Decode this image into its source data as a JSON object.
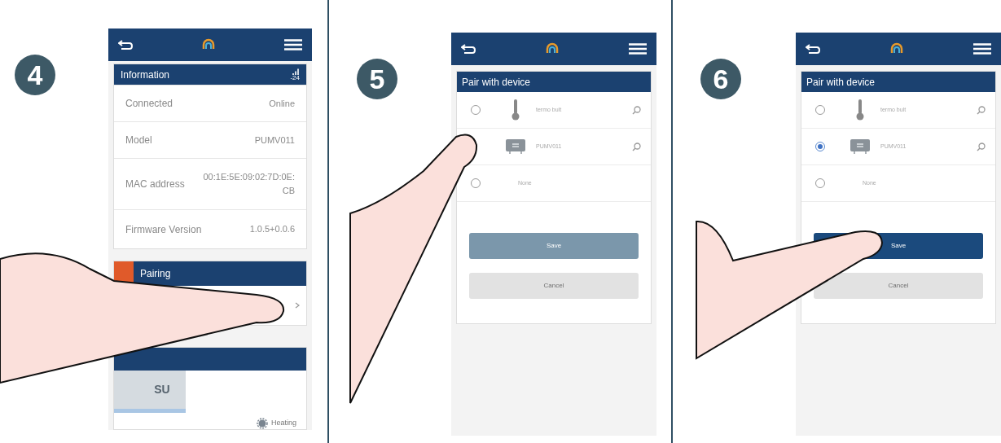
{
  "panels": [
    {
      "step": "4",
      "screen": {
        "kind": "info",
        "info_title": "Information",
        "signal": "-24",
        "rows": [
          {
            "label": "Connected",
            "value": "Online"
          },
          {
            "label": "Model",
            "value": "PUMV011"
          },
          {
            "label": "MAC address",
            "value": "00:1E:5E:09:02:7D:0E:\nCB"
          },
          {
            "label": "Firmware Version",
            "value": "1.0.5+0.0.6"
          }
        ],
        "pairing_title": "Pairing",
        "schedule": "SU",
        "mode": "Heating"
      }
    },
    {
      "step": "5",
      "screen": {
        "kind": "pair",
        "title": "Pair with device",
        "devices": [
          {
            "kind": "thermometer",
            "name": "termo bult",
            "selected": false
          },
          {
            "kind": "controller",
            "name": "PUMV011"
          },
          {
            "kind": "none",
            "name": "None",
            "selected": false
          }
        ],
        "save": {
          "label": "Save",
          "enabled": false
        },
        "cancel": "Cancel"
      }
    },
    {
      "step": "6",
      "screen": {
        "kind": "pair",
        "title": "Pair with device",
        "devices": [
          {
            "kind": "thermometer",
            "name": "termo bult",
            "selected": false
          },
          {
            "kind": "controller",
            "name": "PUMV011",
            "selected": true
          },
          {
            "kind": "none",
            "name": "None",
            "selected": false
          }
        ],
        "save": {
          "label": "Save",
          "enabled": true
        },
        "cancel": "Cancel"
      }
    }
  ]
}
